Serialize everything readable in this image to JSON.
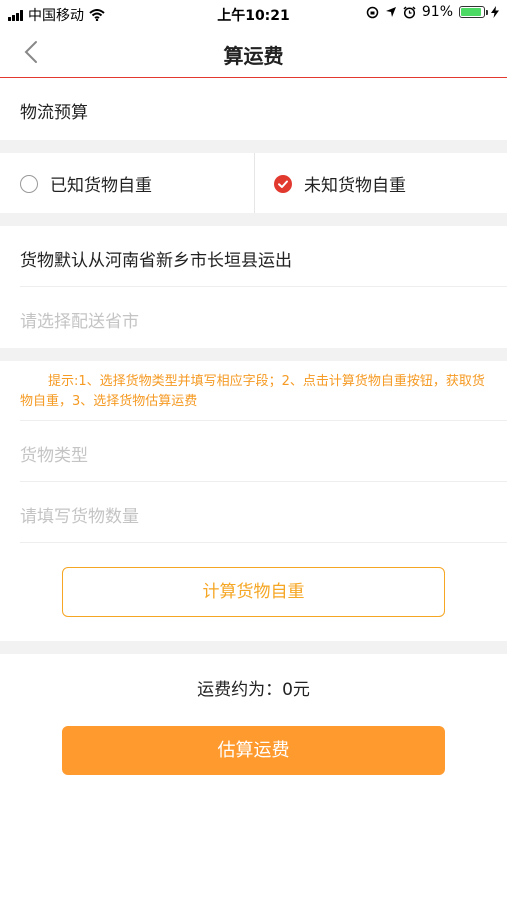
{
  "status_bar": {
    "carrier": "中国移动",
    "time": "上午10:21",
    "battery_percent": "91%",
    "battery_level": 0.91,
    "icons": [
      "signal-icon",
      "wifi-icon",
      "orientation-lock-icon",
      "location-icon",
      "alarm-icon",
      "battery-icon",
      "charging-icon"
    ]
  },
  "nav": {
    "title": "算运费",
    "back_icon": "chevron-left-icon",
    "divider_color": "#e2392f"
  },
  "section": {
    "title": "物流预算"
  },
  "weight_mode": {
    "options": [
      {
        "label": "已知货物自重",
        "selected": false
      },
      {
        "label": "未知货物自重",
        "selected": true
      }
    ],
    "selected_color": "#e2392f"
  },
  "origin": {
    "text": "货物默认从河南省新乡市长垣县运出"
  },
  "destination": {
    "placeholder": "请选择配送省市"
  },
  "hint": {
    "text": "提示:1、选择货物类型并填写相应字段；2、点击计算货物自重按钮，获取货物自重，3、选择货物估算运费"
  },
  "cargo_type": {
    "placeholder": "货物类型"
  },
  "cargo_quantity": {
    "placeholder": "请填写货物数量"
  },
  "calc_weight_button": {
    "label": "计算货物自重"
  },
  "fee": {
    "text": "运费约为：0元"
  },
  "estimate_button": {
    "label": "估算运费",
    "color": "#ff9a2e"
  },
  "colors": {
    "accent_orange": "#f5a623",
    "accent_red": "#e2392f",
    "section_gap": "#f2f2f2"
  }
}
